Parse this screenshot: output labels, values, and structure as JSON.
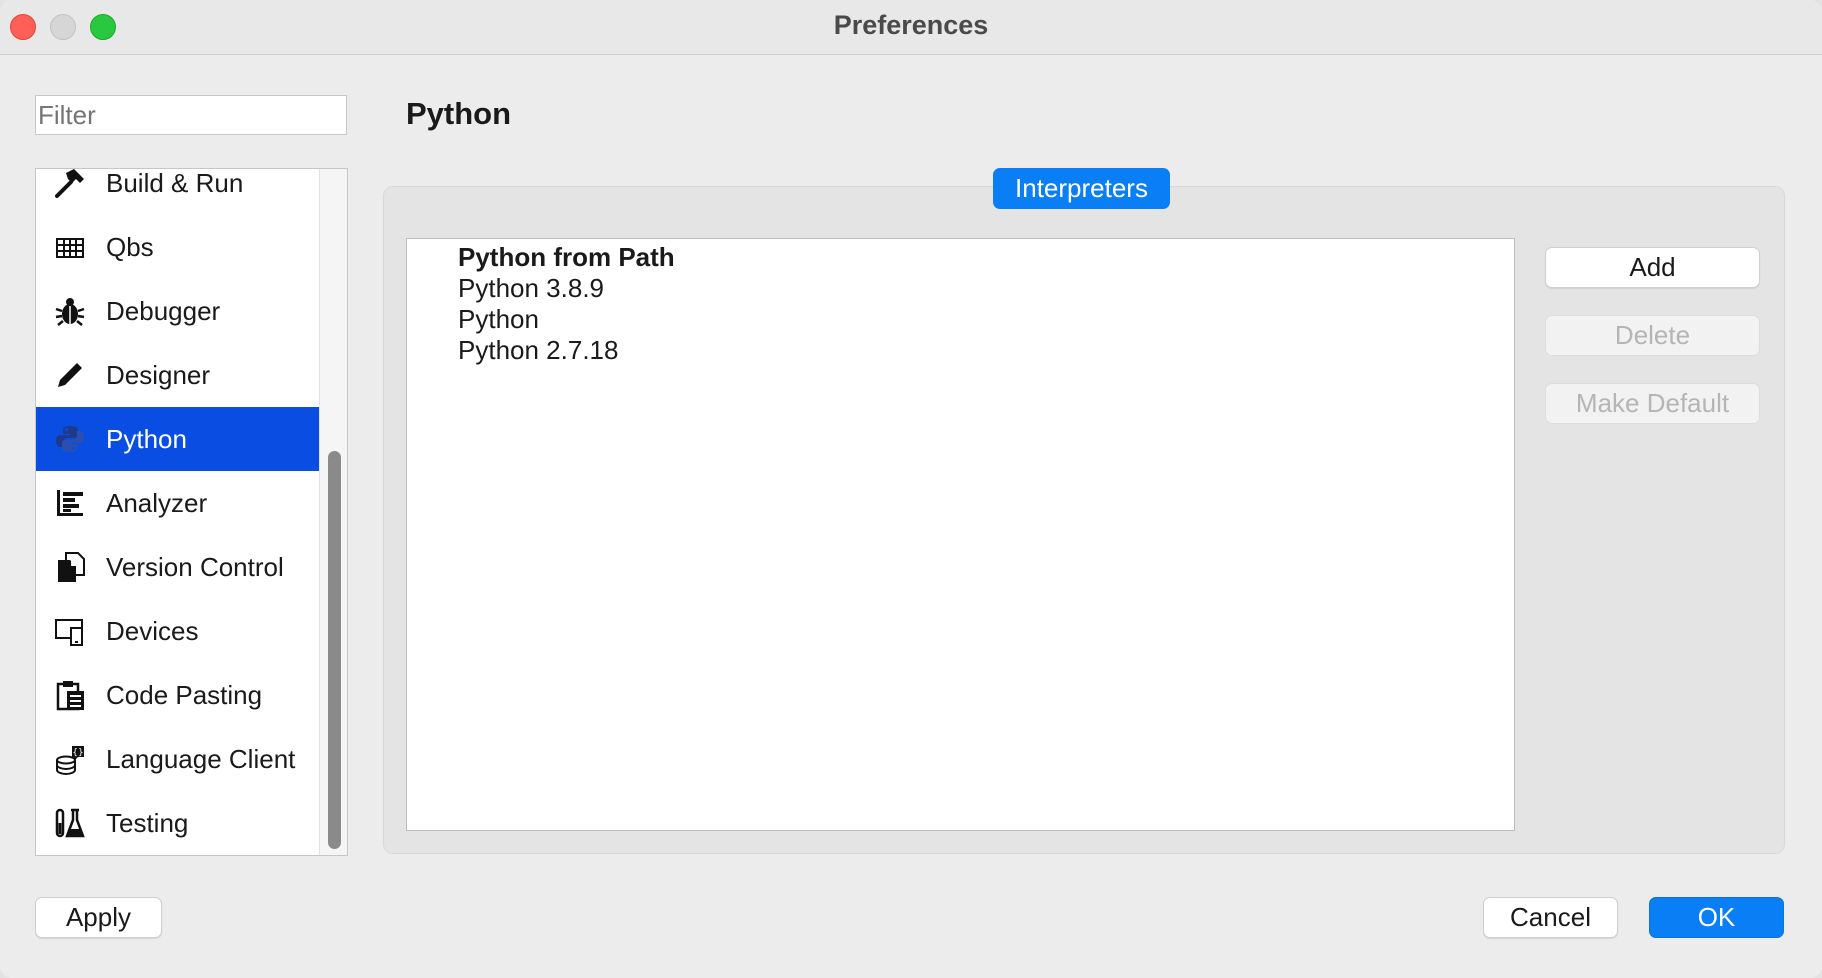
{
  "window": {
    "title": "Preferences"
  },
  "filter": {
    "placeholder": "Filter"
  },
  "sidebar": {
    "items": [
      {
        "label": "Build & Run",
        "icon": "hammer-icon"
      },
      {
        "label": "Qbs",
        "icon": "grid-icon"
      },
      {
        "label": "Debugger",
        "icon": "bug-icon"
      },
      {
        "label": "Designer",
        "icon": "pencil-icon"
      },
      {
        "label": "Python",
        "icon": "python-icon",
        "selected": true
      },
      {
        "label": "Analyzer",
        "icon": "analyzer-icon"
      },
      {
        "label": "Version Control",
        "icon": "documents-icon"
      },
      {
        "label": "Devices",
        "icon": "devices-icon"
      },
      {
        "label": "Code Pasting",
        "icon": "clipboard-icon"
      },
      {
        "label": "Language Client",
        "icon": "language-client-icon"
      },
      {
        "label": "Testing",
        "icon": "flask-icon"
      }
    ]
  },
  "main": {
    "title": "Python",
    "tab": "Interpreters",
    "interpreters": [
      {
        "label": "Python from Path",
        "default": true
      },
      {
        "label": "Python 3.8.9"
      },
      {
        "label": "Python"
      },
      {
        "label": "Python 2.7.18"
      }
    ],
    "buttons": {
      "add": "Add",
      "delete": "Delete",
      "make_default": "Make Default"
    }
  },
  "footer": {
    "apply": "Apply",
    "cancel": "Cancel",
    "ok": "OK"
  },
  "colors": {
    "accent": "#0a7ef5",
    "selection": "#0a4de3"
  }
}
